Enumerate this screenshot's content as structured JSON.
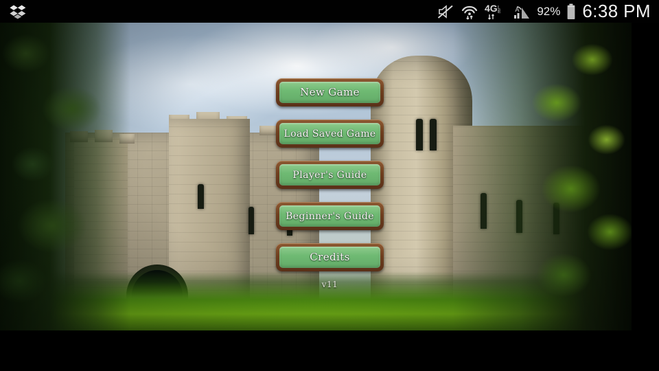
{
  "status_bar": {
    "notification_icon": "dropbox-icon",
    "icons": [
      "silent-mode-icon",
      "wifi-icon",
      "4g-lte-icon",
      "cellular-signal-icon"
    ],
    "network_label": "4G",
    "battery_percent": "92%",
    "clock": "6:38 PM"
  },
  "game": {
    "title_screen": "castle-main-menu",
    "version": "v11",
    "menu": [
      {
        "id": "new-game",
        "label": "New Game"
      },
      {
        "id": "load-saved-game",
        "label": "Load Saved Game"
      },
      {
        "id": "players-guide",
        "label": "Player's Guide"
      },
      {
        "id": "beginners-guide",
        "label": "Beginner's Guide"
      },
      {
        "id": "credits",
        "label": "Credits"
      }
    ],
    "colors": {
      "button_fill": "#6fba73",
      "button_border": "#6f3f1f",
      "button_text": "#fdfdfb",
      "letterbox": "#000000"
    },
    "background": {
      "scene": "stone-castle-with-gate-and-round-tower",
      "foreground_left": "dark-green-foliage",
      "foreground_right": "bright-green-foliage",
      "ground": "green-grass",
      "sky": "blue-sky-with-clouds"
    }
  }
}
